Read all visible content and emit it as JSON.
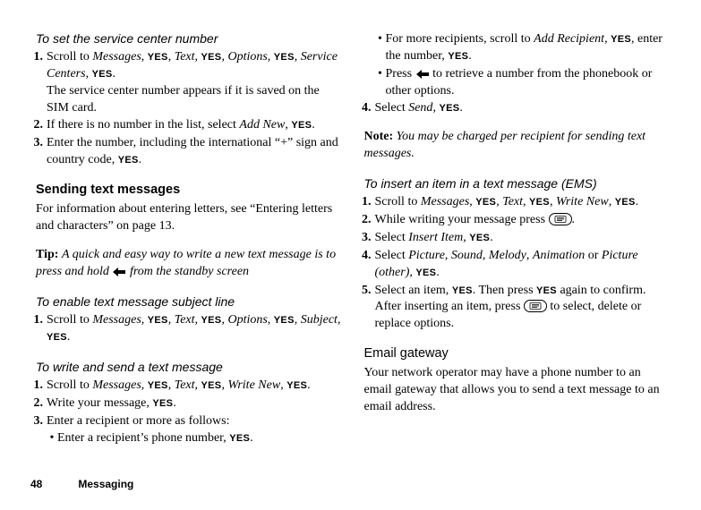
{
  "col1": {
    "h_service": "To set the service center number",
    "steps_service": [
      {
        "num": "1.",
        "parts": [
          "Scroll to ",
          "Messages",
          ", ",
          "YES",
          ", ",
          "Text",
          ", ",
          "YES",
          ", ",
          "Options",
          ", ",
          "YES",
          ", ",
          "Service Centers",
          ", ",
          "YES",
          "."
        ],
        "after": "The service center number appears if it is saved on the SIM card."
      },
      {
        "num": "2.",
        "parts": [
          "If there is no number in the list, select ",
          "Add New",
          ", ",
          "YES",
          "."
        ]
      },
      {
        "num": "3.",
        "parts": [
          "Enter the number, including the international “+” sign and country code, ",
          "YES",
          "."
        ]
      }
    ],
    "h_sending": "Sending text messages",
    "p_sending": "For information about entering letters, see “Entering letters and characters” on page 13.",
    "tip_label": "Tip:",
    "tip_body_a": "A quick and easy way to write a new text message is to press and hold ",
    "tip_body_b": " from the standby screen",
    "h_subject": "To enable text message subject line",
    "steps_subject": [
      {
        "num": "1.",
        "parts": [
          "Scroll to ",
          "Messages",
          ", ",
          "YES",
          ", ",
          "Text",
          ", ",
          "YES",
          ", ",
          "Options",
          ", ",
          "YES",
          ", ",
          "Subject",
          ", ",
          "YES",
          "."
        ]
      }
    ],
    "h_write": "To write and send a text message",
    "steps_write": [
      {
        "num": "1.",
        "parts": [
          "Scroll to ",
          "Messages",
          ", ",
          "YES",
          ", ",
          "Text",
          ", ",
          "YES",
          ", ",
          "Write New",
          ", ",
          "YES",
          "."
        ]
      },
      {
        "num": "2.",
        "parts": [
          "Write your message, ",
          "YES",
          "."
        ]
      },
      {
        "num": "3.",
        "parts": [
          "Enter a recipient or more as follows:"
        ]
      }
    ],
    "bullet_write_a": [
      "Enter a recipient’s phone number, ",
      "YES",
      "."
    ]
  },
  "col2": {
    "bullet_top_a": [
      "For more recipients, scroll to ",
      "Add Recipient",
      ", ",
      "YES",
      ", enter the number, ",
      "YES",
      "."
    ],
    "bullet_top_b_a": "Press ",
    "bullet_top_b_b": " to retrieve a number from the phonebook or other options.",
    "steps_cont": [
      {
        "num": "4.",
        "parts": [
          "Select ",
          "Send",
          ", ",
          "YES",
          "."
        ]
      }
    ],
    "note_label": "Note:",
    "note_body": "You may be charged per recipient for sending text messages.",
    "h_insert": "To insert an item in a text message (EMS)",
    "steps_insert": [
      {
        "num": "1.",
        "parts": [
          "Scroll to ",
          "Messages",
          ", ",
          "YES",
          ", ",
          "Text",
          ", ",
          "YES",
          ", ",
          "Write New",
          ", ",
          "YES",
          "."
        ]
      },
      {
        "num": "2.",
        "parts_a": "While writing your message press ",
        "key": true,
        "parts_b": "."
      },
      {
        "num": "3.",
        "parts": [
          "Select ",
          "Insert Item",
          ", ",
          "YES",
          "."
        ]
      },
      {
        "num": "4.",
        "parts": [
          "Select ",
          "Picture",
          ", ",
          "Sound",
          ", ",
          "Melody",
          ", ",
          "Animation",
          " or ",
          "Picture (other)",
          ", ",
          "YES",
          "."
        ]
      },
      {
        "num": "5.",
        "parts_a": "Select an item, ",
        "parts_b": ". Then press ",
        "parts_c": " again to confirm. After inserting an item, press ",
        "key": true,
        "parts_d": " to select, delete or replace options."
      }
    ],
    "h_email": "Email gateway",
    "p_email": "Your network operator may have a phone number to an email gateway that allows you to send a text message to an email address."
  },
  "footer": {
    "page": "48",
    "section": "Messaging"
  }
}
